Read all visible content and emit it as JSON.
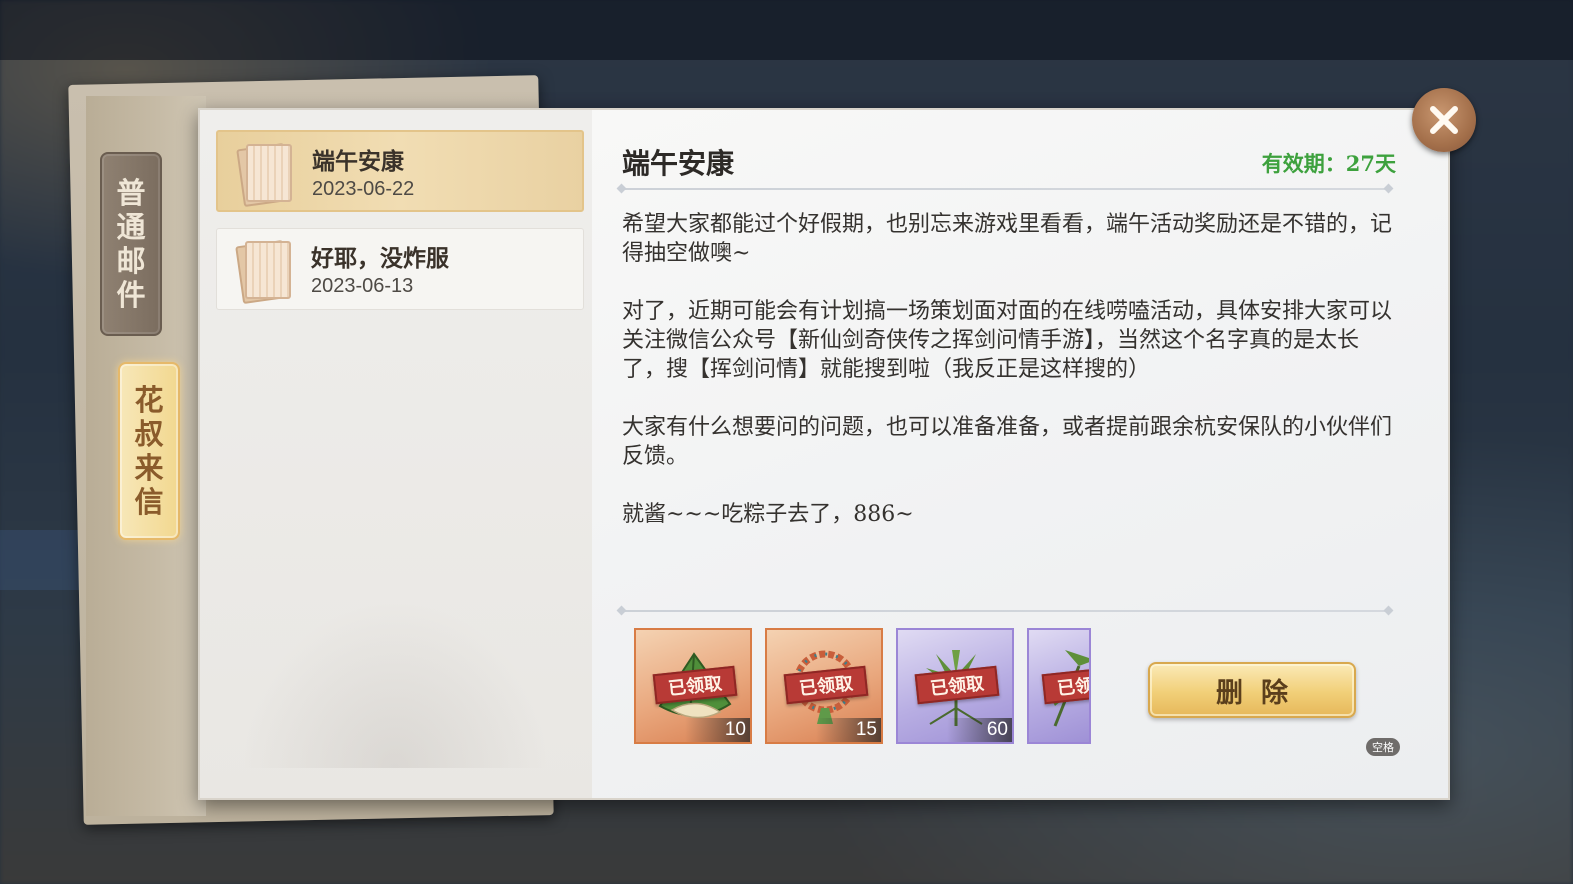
{
  "tabs": {
    "normal_mail": [
      "普",
      "通",
      "邮",
      "件"
    ],
    "uncle_letter": [
      "花",
      "叔",
      "来",
      "信"
    ]
  },
  "mail_list": [
    {
      "title": "端午安康",
      "date": "2023-06-22",
      "selected": true
    },
    {
      "title": "好耶，没炸服",
      "date": "2023-06-13",
      "selected": false
    }
  ],
  "detail": {
    "title": "端午安康",
    "validity": "有效期：27天",
    "paragraphs": [
      "希望大家都能过个好假期，也别忘来游戏里看看，端午活动奖励还是不错的，记得抽空做噢~",
      "对了，近期可能会有计划搞一场策划面对面的在线唠嗑活动，具体安排大家可以关注微信公众号【新仙剑奇侠传之挥剑问情手游】，当然这个名字真的是太长了，搜【挥剑问情】就能搜到啦（我反正是这样搜的）",
      "大家有什么想要问的问题，也可以准备准备，或者提前跟余杭安保队的小伙伴们反馈。",
      "就酱~~~吃粽子去了，886~"
    ]
  },
  "rewards": [
    {
      "icon": "zongzi-icon",
      "stamp": "已领取",
      "count": "10",
      "rarity": "orange"
    },
    {
      "icon": "bracelet-icon",
      "stamp": "已领取",
      "count": "15",
      "rarity": "orange"
    },
    {
      "icon": "herb-icon",
      "stamp": "已领取",
      "count": "60",
      "rarity": "purple"
    },
    {
      "icon": "herb-icon",
      "stamp": "已领取",
      "count": "",
      "rarity": "purple"
    }
  ],
  "delete_button": "删除",
  "key_hint": "空格",
  "colors": {
    "validity_green": "#3da13d",
    "stamp_red": "#b83a36",
    "button_gold": "#f1cf78"
  }
}
